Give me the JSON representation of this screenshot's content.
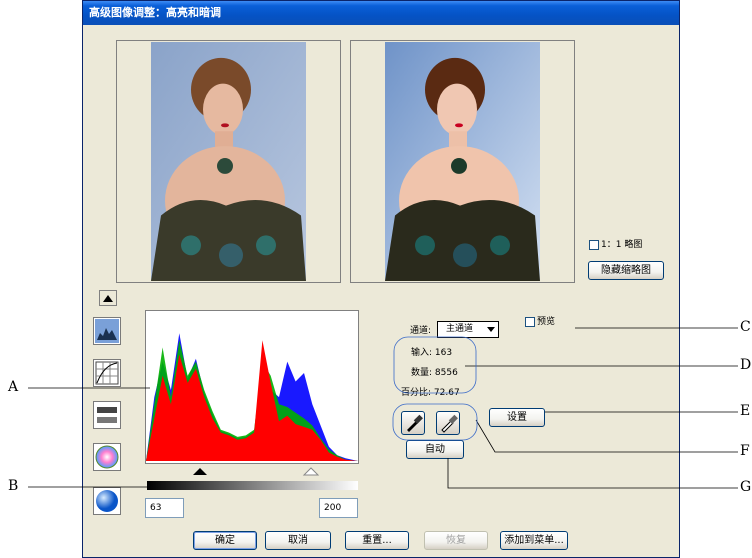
{
  "window": {
    "title": "高级图像调整：高亮和暗调"
  },
  "preview": {
    "ratio_label": "1：1 略图",
    "hide_thumbnail_button": "隐藏缩略图"
  },
  "controls": {
    "channel_label": "通道:",
    "channel_value": "主通道",
    "preview_label": "预览",
    "input_label": "输入:",
    "input_value": "163",
    "count_label": "数量:",
    "count_value": "8556",
    "percent_label": "百分比:",
    "percent_value": "72.67",
    "settings_button": "设置",
    "auto_button": "自动",
    "low_value": "63",
    "high_value": "200"
  },
  "buttons": {
    "ok": "确定",
    "cancel": "取消",
    "reset": "重置...",
    "restore": "恢复",
    "add_to_menu": "添加到菜单..."
  },
  "callouts": {
    "a": "A",
    "b": "B",
    "c": "C",
    "d": "D",
    "e": "E",
    "f": "F",
    "g": "G"
  },
  "colors": {
    "title_bar": "#0553c5",
    "dialog_bg": "#ece9d8",
    "histogram_red": "#ff0000",
    "histogram_green": "#00b000",
    "histogram_blue": "#0000ff"
  },
  "chart_data": {
    "type": "area",
    "title": "",
    "xlabel": "",
    "ylabel": "",
    "xlim": [
      0,
      255
    ],
    "ylim": [
      0,
      100
    ],
    "series": [
      {
        "color": "red",
        "x": [
          0,
          10,
          20,
          30,
          40,
          50,
          60,
          70,
          80,
          90,
          100,
          110,
          120,
          130,
          140,
          150,
          160,
          170,
          180,
          190,
          200,
          210,
          220,
          230,
          240,
          255
        ],
        "values": [
          0,
          30,
          60,
          40,
          75,
          55,
          65,
          45,
          30,
          20,
          18,
          15,
          16,
          20,
          85,
          55,
          28,
          32,
          26,
          24,
          22,
          15,
          6,
          3,
          1,
          0
        ]
      },
      {
        "color": "green",
        "x": [
          0,
          10,
          20,
          30,
          40,
          50,
          60,
          70,
          80,
          90,
          100,
          110,
          120,
          130,
          140,
          150,
          160,
          170,
          180,
          190,
          200,
          210,
          220,
          230,
          240,
          255
        ],
        "values": [
          0,
          40,
          80,
          45,
          85,
          60,
          70,
          50,
          35,
          22,
          20,
          17,
          18,
          22,
          70,
          60,
          40,
          38,
          34,
          30,
          25,
          16,
          8,
          4,
          1,
          0
        ]
      },
      {
        "color": "blue",
        "x": [
          0,
          10,
          20,
          30,
          40,
          50,
          60,
          70,
          80,
          90,
          100,
          110,
          120,
          130,
          140,
          150,
          160,
          170,
          180,
          190,
          200,
          210,
          220,
          230,
          240,
          255
        ],
        "values": [
          0,
          45,
          70,
          50,
          90,
          58,
          72,
          48,
          33,
          21,
          19,
          16,
          17,
          21,
          60,
          50,
          45,
          70,
          56,
          62,
          40,
          25,
          10,
          4,
          2,
          0
        ]
      }
    ]
  }
}
